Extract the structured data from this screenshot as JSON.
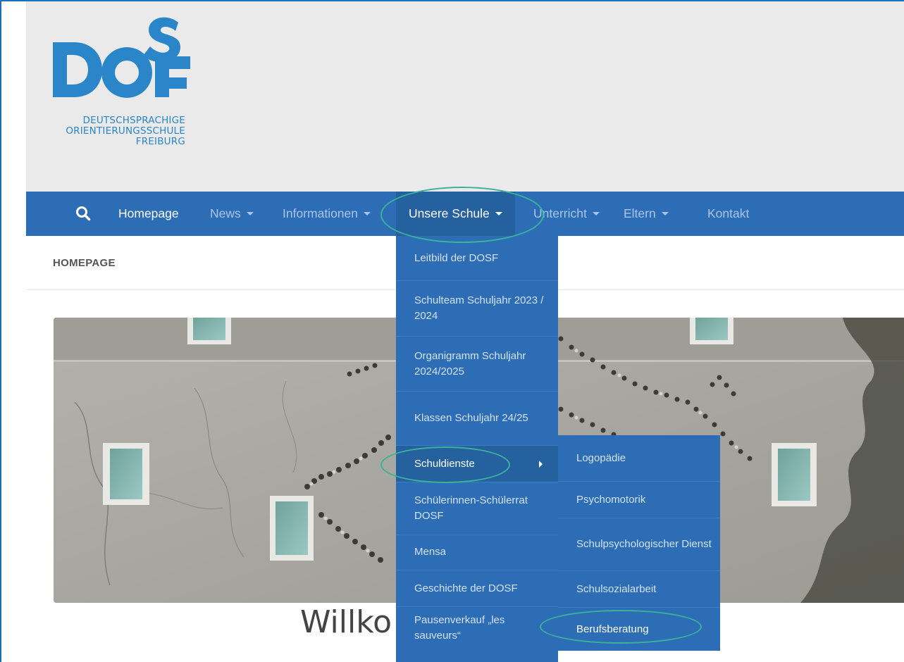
{
  "logo": {
    "line1": "DEUTSCHSPRACHIGE",
    "line2": "ORIENTIERUNGSSCHULE",
    "line3": "FREIBURG",
    "brand_color": "#2a86c8"
  },
  "nav": {
    "bg_color": "#2d6db5",
    "items": [
      {
        "label": "Homepage"
      },
      {
        "label": "News"
      },
      {
        "label": "Informationen"
      },
      {
        "label": "Unsere Schule"
      },
      {
        "label": "Unterricht"
      },
      {
        "label": "Eltern"
      },
      {
        "label": "Kontakt"
      }
    ]
  },
  "breadcrumb": "HOMEPAGE",
  "submenu": {
    "items": [
      {
        "label": "Leitbild der DOSF"
      },
      {
        "label": "Schulteam Schuljahr 2023 / 2024"
      },
      {
        "label": "Organigramm Schuljahr 2024/2025"
      },
      {
        "label": "Klassen Schuljahr 24/25"
      },
      {
        "label": "Schuldienste"
      },
      {
        "label": "Schülerinnen-Schülerrat DOSF"
      },
      {
        "label": "Mensa"
      },
      {
        "label": "Geschichte der DOSF"
      },
      {
        "label": "Pausenverkauf „les sauveurs“"
      }
    ]
  },
  "submenu2": {
    "items": [
      {
        "label": "Logopädie"
      },
      {
        "label": "Psychomotorik"
      },
      {
        "label": "Schulpsychologischer Dienst"
      },
      {
        "label": "Schulsozialarbeit"
      },
      {
        "label": "Berufsberatung"
      }
    ]
  },
  "welcome_text": "Willko",
  "annotation_color": "#3ab39a"
}
